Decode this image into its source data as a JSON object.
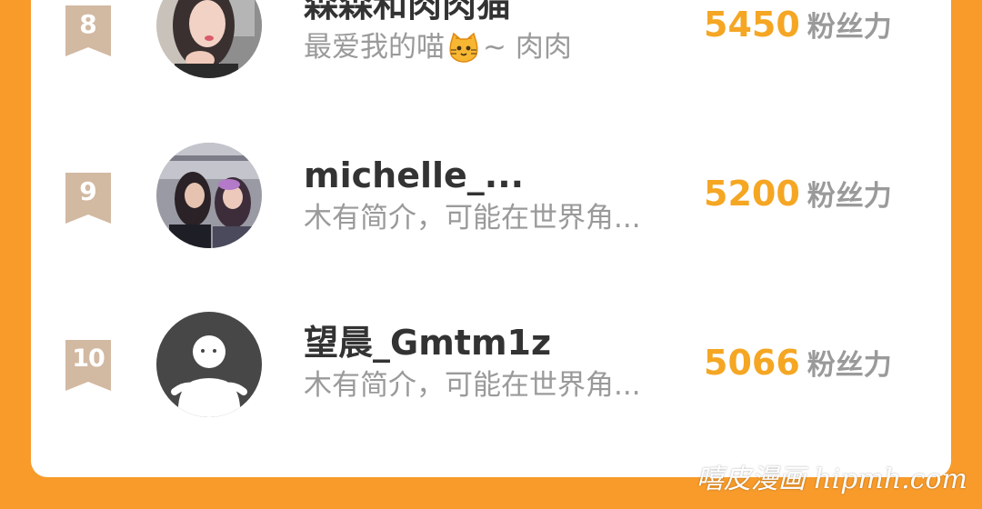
{
  "leaderboard": {
    "rows": [
      {
        "rank": "8",
        "name": "森森和肉肉猫",
        "bio_before": "最爱我的喵",
        "bio_icon": "cat-face-icon",
        "bio_after": "~ 肉肉",
        "score": "5450",
        "unit": "粉丝力",
        "avatar": "user-photo-avatar"
      },
      {
        "rank": "9",
        "name": "michelle_...",
        "bio": "木有简介，可能在世界角...",
        "score": "5200",
        "unit": "粉丝力",
        "avatar": "group-photo-avatar"
      },
      {
        "rank": "10",
        "name": "望晨_Gmtm1z",
        "bio": "木有简介，可能在世界角...",
        "score": "5066",
        "unit": "粉丝力",
        "avatar": "default-avatar-icon"
      }
    ]
  },
  "watermark": "嘻皮漫画 hipmh.com",
  "colors": {
    "background": "#F89B2A",
    "card": "#FFFFFF",
    "rank_badge": "#D2B9A2",
    "score": "#F5A623",
    "name": "#333333",
    "muted": "#9A9A9A"
  }
}
